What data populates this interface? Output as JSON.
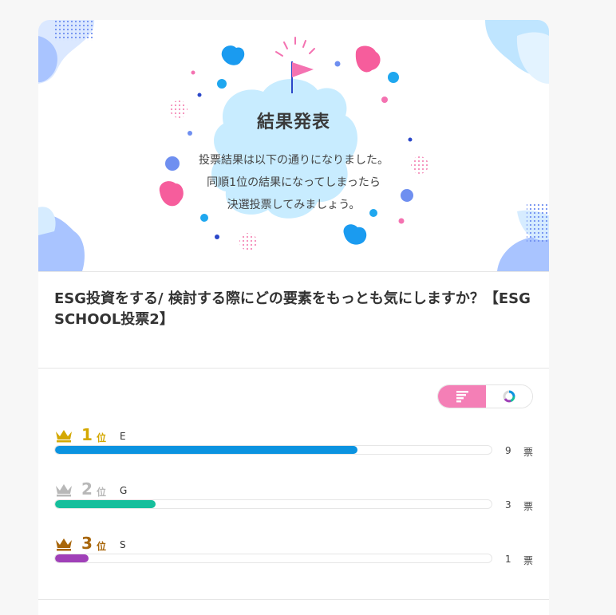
{
  "hero": {
    "title": "結果発表",
    "lines": [
      "投票結果は以下の通りになりました。",
      "同順1位の結果になってしまったら",
      "決選投票してみましょう。"
    ]
  },
  "question": "ESG投資をする/ 検討する際にどの要素をもっとも気にしますか？【ESG SCHOOL投票2】",
  "view_toggle": {
    "active": "bar",
    "options": [
      "bar-chart-view",
      "pie-chart-view"
    ],
    "active_color": "#f47fb6"
  },
  "results": {
    "rank_suffix": "位",
    "unit": "票",
    "max_votes": 13,
    "items": [
      {
        "rank": "1",
        "name": "E",
        "votes": 9,
        "bar_color": "#0b93e0",
        "rank_color": "#d4a800"
      },
      {
        "rank": "2",
        "name": "G",
        "votes": 3,
        "bar_color": "#16bf9c",
        "rank_color": "#b8b8b8"
      },
      {
        "rank": "3",
        "name": "S",
        "votes": 1,
        "bar_color": "#a040b8",
        "rank_color": "#a8660a"
      }
    ]
  }
}
